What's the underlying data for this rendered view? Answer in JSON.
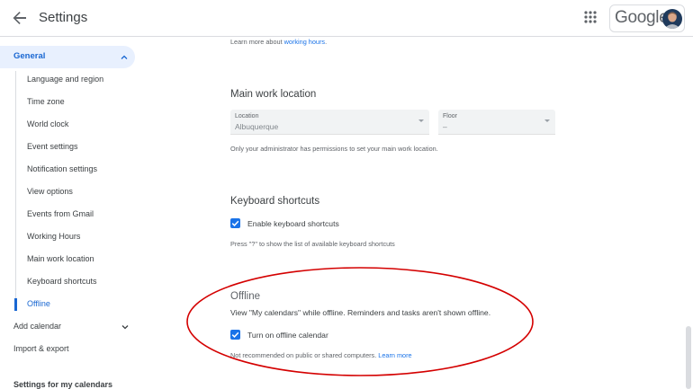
{
  "header": {
    "title": "Settings",
    "logo": "Google",
    "icons": {
      "back": "arrow-back-icon",
      "apps": "apps-grid-icon"
    }
  },
  "sidebar": {
    "general_label": "General",
    "general_items": [
      {
        "label": "Language and region"
      },
      {
        "label": "Time zone"
      },
      {
        "label": "World clock"
      },
      {
        "label": "Event settings"
      },
      {
        "label": "Notification settings"
      },
      {
        "label": "View options"
      },
      {
        "label": "Events from Gmail"
      },
      {
        "label": "Working Hours"
      },
      {
        "label": "Main work location"
      },
      {
        "label": "Keyboard shortcuts"
      },
      {
        "label": "Offline",
        "active": true
      }
    ],
    "add_calendar": "Add calendar",
    "import_export": "Import & export",
    "settings_for_calendars": "Settings for my calendars"
  },
  "main": {
    "working_hours_prefix": "Learn more about ",
    "working_hours_link": "working hours",
    "working_hours_suffix": ".",
    "main_work_location": {
      "title": "Main work location",
      "location_label": "Location",
      "location_value": "Albuquerque",
      "floor_label": "Floor",
      "floor_value": "–",
      "note": "Only your administrator has permissions to set your main work location."
    },
    "keyboard_shortcuts": {
      "title": "Keyboard shortcuts",
      "checkbox_label": "Enable keyboard shortcuts",
      "checked": true,
      "note": "Press \"?\" to show the list of available keyboard shortcuts"
    },
    "offline": {
      "title": "Offline",
      "description": "View \"My calendars\" while offline. Reminders and tasks aren't shown offline.",
      "checkbox_label": "Turn on offline calendar",
      "checked": true,
      "note_prefix": "Not recommended on public or shared computers. ",
      "note_link": "Learn more"
    }
  },
  "colors": {
    "accent": "#1a73e8",
    "active_text": "#1967d2",
    "active_bg": "#e8f0fe",
    "annotation": "#d40000"
  }
}
